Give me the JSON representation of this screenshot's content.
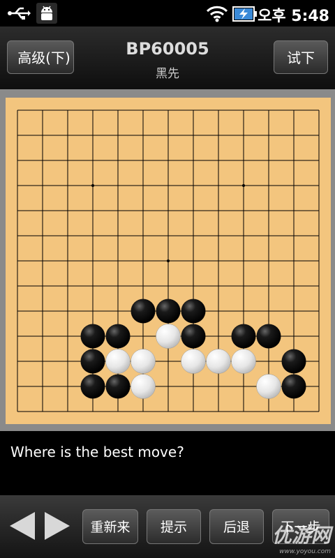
{
  "status_bar": {
    "time": "오후 5:48",
    "icons": [
      "usb-icon",
      "android-debug-icon",
      "wifi-icon",
      "battery-charging-icon"
    ]
  },
  "header": {
    "back_label": "高级(下)",
    "title": "BP60005",
    "subtitle": "黑先",
    "try_label": "试下"
  },
  "board": {
    "size": 13,
    "star_points": [
      [
        3,
        3
      ],
      [
        9,
        3
      ],
      [
        6,
        6
      ]
    ],
    "stones": [
      {
        "col": 5,
        "row": 8,
        "color": "black"
      },
      {
        "col": 6,
        "row": 8,
        "color": "black"
      },
      {
        "col": 7,
        "row": 8,
        "color": "black"
      },
      {
        "col": 3,
        "row": 9,
        "color": "black"
      },
      {
        "col": 4,
        "row": 9,
        "color": "black"
      },
      {
        "col": 6,
        "row": 9,
        "color": "white"
      },
      {
        "col": 7,
        "row": 9,
        "color": "black"
      },
      {
        "col": 9,
        "row": 9,
        "color": "black"
      },
      {
        "col": 10,
        "row": 9,
        "color": "black"
      },
      {
        "col": 3,
        "row": 10,
        "color": "black"
      },
      {
        "col": 4,
        "row": 10,
        "color": "white"
      },
      {
        "col": 5,
        "row": 10,
        "color": "white"
      },
      {
        "col": 7,
        "row": 10,
        "color": "white"
      },
      {
        "col": 8,
        "row": 10,
        "color": "white"
      },
      {
        "col": 9,
        "row": 10,
        "color": "white"
      },
      {
        "col": 11,
        "row": 10,
        "color": "black"
      },
      {
        "col": 3,
        "row": 11,
        "color": "black"
      },
      {
        "col": 4,
        "row": 11,
        "color": "black"
      },
      {
        "col": 5,
        "row": 11,
        "color": "white"
      },
      {
        "col": 10,
        "row": 11,
        "color": "white"
      },
      {
        "col": 11,
        "row": 11,
        "color": "black"
      }
    ]
  },
  "question": "Where is the best move?",
  "toolbar": {
    "prev_icon": "arrow-left-icon",
    "next_icon": "arrow-right-icon",
    "restart_label": "重新来",
    "hint_label": "提示",
    "undo_label": "后退",
    "next_step_label": "下一步"
  },
  "watermark": {
    "text": "优游网",
    "url": "www.yoyou.com"
  }
}
